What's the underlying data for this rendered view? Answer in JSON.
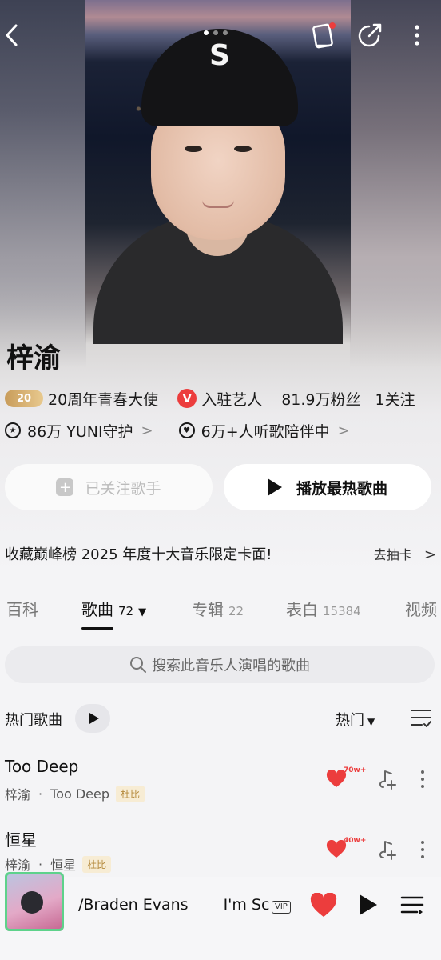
{
  "artist": {
    "name": "梓渝",
    "anniversary_badge": "20",
    "anniversary_text": "20周年青春大使",
    "verified_badge": "V",
    "verified_text": "入驻艺人",
    "fans": "81.9万粉丝",
    "following": "1关注",
    "guard_text": "86万 YUNI守护",
    "listening_text": "6万+人听歌陪伴中"
  },
  "buttons": {
    "follow_label": "已关注歌手",
    "play_hot_label": "播放最热歌曲"
  },
  "promo": {
    "text": "收藏巅峰榜 2025 年度十大音乐限定卡面!",
    "action": "去抽卡"
  },
  "tabs": [
    {
      "label": "百科",
      "count": ""
    },
    {
      "label": "歌曲",
      "count": "72"
    },
    {
      "label": "专辑",
      "count": "22"
    },
    {
      "label": "表白",
      "count": "15384"
    },
    {
      "label": "视频",
      "count": ""
    }
  ],
  "search": {
    "placeholder": "搜索此音乐人演唱的歌曲"
  },
  "hot_songs": {
    "title": "热门歌曲",
    "sort_label": "热门"
  },
  "songs": [
    {
      "title": "Too Deep",
      "artist": "梓渝",
      "album": "Too Deep",
      "tag": "杜比",
      "likes": "70w+"
    },
    {
      "title": "恒星",
      "artist": "梓渝",
      "album": "恒星",
      "tag": "杜比",
      "likes": "40w+"
    }
  ],
  "player": {
    "track_part1": "/Braden Evans",
    "track_part2": "I'm Sc",
    "vip": "VIP"
  },
  "colors": {
    "accent_red": "#ec3d3d",
    "gold": "#c89c5a",
    "background": "#f4f4f6"
  }
}
